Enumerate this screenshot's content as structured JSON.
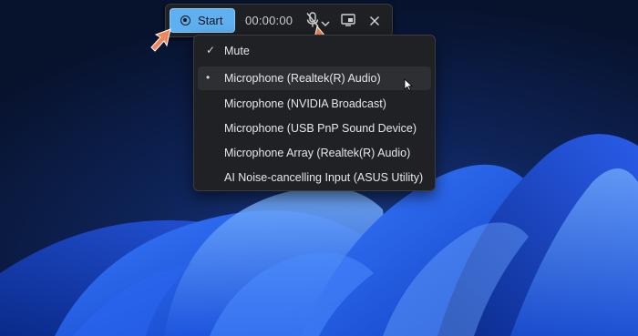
{
  "toolbar": {
    "start_label": "Start",
    "timer": "00:00:00",
    "icons": [
      "record-icon",
      "mic-muted-icon",
      "chevron-down-icon",
      "screen-icon",
      "close-icon"
    ]
  },
  "audio_menu": {
    "items": [
      {
        "label": "Mute",
        "mark": "✓"
      },
      {
        "label": "Microphone (Realtek(R) Audio)",
        "mark": "•"
      },
      {
        "label": "Microphone (NVIDIA Broadcast)",
        "mark": ""
      },
      {
        "label": "Microphone (USB PnP Sound Device)",
        "mark": ""
      },
      {
        "label": "Microphone Array (Realtek(R) Audio)",
        "mark": ""
      },
      {
        "label": "AI Noise-cancelling Input (ASUS Utility)",
        "mark": ""
      }
    ]
  },
  "colors": {
    "accent": "#5fb0f0",
    "menu_bg": "#202124",
    "annotation_arrow": "#f0875a"
  }
}
